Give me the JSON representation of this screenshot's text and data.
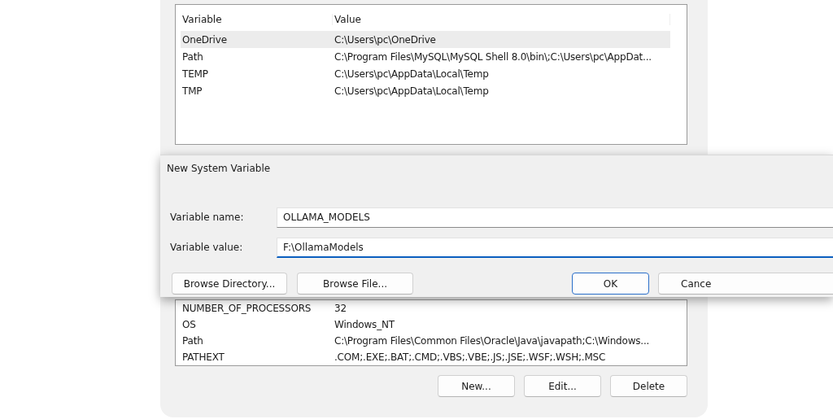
{
  "user_variables": {
    "columns": [
      "Variable",
      "Value"
    ],
    "rows": [
      {
        "variable": "OneDrive",
        "value": "C:\\Users\\pc\\OneDrive",
        "selected": true
      },
      {
        "variable": "Path",
        "value": "C:\\Program Files\\MySQL\\MySQL Shell 8.0\\bin\\;C:\\Users\\pc\\AppDat...",
        "selected": false
      },
      {
        "variable": "TEMP",
        "value": "C:\\Users\\pc\\AppData\\Local\\Temp",
        "selected": false
      },
      {
        "variable": "TMP",
        "value": "C:\\Users\\pc\\AppData\\Local\\Temp",
        "selected": false
      }
    ]
  },
  "dialog": {
    "title": "New System Variable",
    "fields": [
      {
        "label": "Variable name:",
        "value": "OLLAMA_MODELS",
        "focused": false
      },
      {
        "label": "Variable value:",
        "value": "F:\\OllamaModels",
        "focused": true
      }
    ],
    "buttons": [
      {
        "label": "Browse Directory...",
        "kind": "left",
        "default": false
      },
      {
        "label": "Browse File...",
        "kind": "left",
        "default": false
      },
      {
        "label": "OK",
        "kind": "right",
        "default": true
      },
      {
        "label": "Cance",
        "kind": "right",
        "default": false
      }
    ]
  },
  "system_variables": {
    "rows": [
      {
        "variable": "NUMBER_OF_PROCESSORS",
        "value": "32",
        "selected": false
      },
      {
        "variable": "OS",
        "value": "Windows_NT",
        "selected": false
      },
      {
        "variable": "Path",
        "value": "C:\\Program Files\\Common Files\\Oracle\\Java\\javapath;C:\\Windows...",
        "selected": false
      },
      {
        "variable": "PATHEXT",
        "value": ".COM;.EXE;.BAT;.CMD;.VBS;.VBE;.JS;.JSE;.WSF;.WSH;.MSC",
        "selected": false
      }
    ]
  },
  "buttons": [
    "New...",
    "Edit...",
    "Delete"
  ]
}
